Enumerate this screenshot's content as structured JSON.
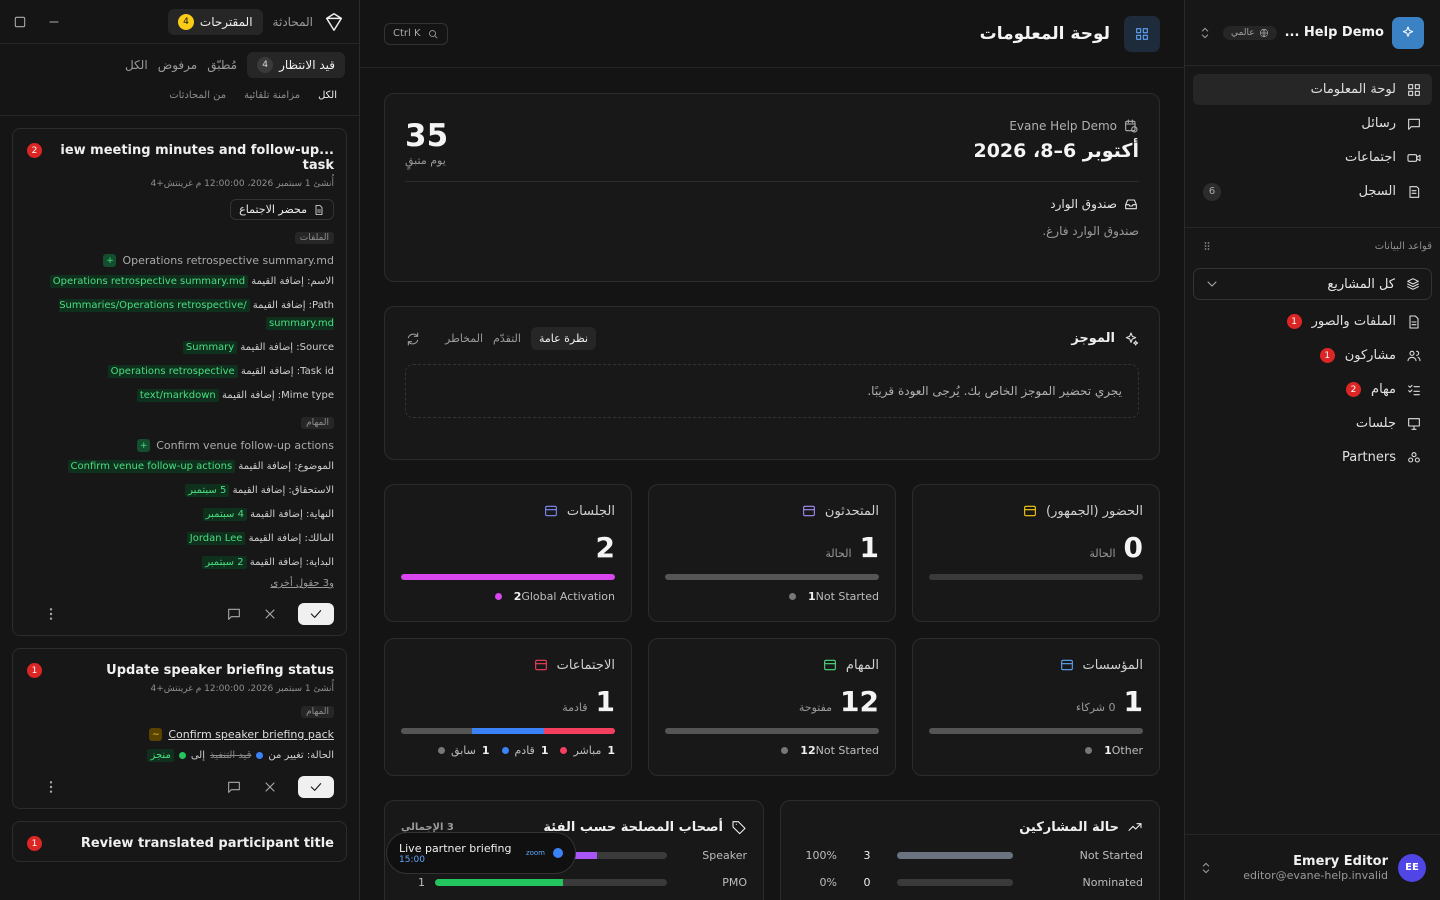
{
  "sidebar": {
    "workspace_name": "Help Demo ...",
    "workspace_badge": "عالمي",
    "nav": [
      {
        "label": "لوحة المعلومات",
        "icon": "dashboard-icon",
        "active": true
      },
      {
        "label": "رسائل",
        "icon": "message-icon"
      },
      {
        "label": "اجتماعات",
        "icon": "video-icon"
      },
      {
        "label": "السجل",
        "icon": "log-icon",
        "count": "6"
      }
    ],
    "section_label": "قواعد البيانات",
    "project_select": "كل المشاريع",
    "db_items": [
      {
        "label": "الملفات والصور",
        "badge": "1"
      },
      {
        "label": "مشاركون",
        "badge": "1"
      },
      {
        "label": "مهام",
        "badge": "2"
      },
      {
        "label": "جلسات",
        "badge": ""
      },
      {
        "label": "Partners",
        "badge": ""
      }
    ],
    "user": {
      "initials": "EE",
      "name": "Emery Editor",
      "email": "editor@evane-help.invalid"
    }
  },
  "left": {
    "tabs": {
      "suggestions": "المقترحات",
      "suggestions_count": "4",
      "conversation": "المحادثة"
    },
    "filters": {
      "pending": "قيد الانتظار",
      "pending_count": "4",
      "applied": "مُطبّق",
      "rejected": "مرفوض",
      "all": "الكل"
    },
    "sources": {
      "all": "الكل",
      "auto_sync": "مزامنة تلقائية",
      "from_chats": "من المحادثات"
    },
    "card1": {
      "badge": "2",
      "title": "...iew meeting minutes and follow-up task",
      "date": "أُنشئ 1 سبتمبر 2026، 12:00:00 م غرينتش+4",
      "doc_button": "محضر الاجتماع",
      "tag_files": "الملفات",
      "file_record": "Operations retrospective summary.md",
      "file_fields": [
        {
          "label": "الاسم: إضافة القيمة",
          "value": "Operations retrospective summary.md"
        },
        {
          "label": "Path: إضافة القيمة",
          "value": "/Summaries/Operations retrospective summary.md"
        },
        {
          "label": "Source: إضافة القيمة",
          "value": "Summary"
        },
        {
          "label": "Task id: إضافة القيمة",
          "value": "Operations retrospective"
        },
        {
          "label": "Mime type: إضافة القيمة",
          "value": "text/markdown"
        }
      ],
      "tag_tasks": "المهام",
      "task_record": "Confirm venue follow-up actions",
      "task_fields": [
        {
          "label": "الموضوع: إضافة القيمة",
          "value": "Confirm venue follow-up actions"
        },
        {
          "label": "الاستحقاق: إضافة القيمة",
          "value": "5 سبتمبر"
        },
        {
          "label": "النهاية: إضافة القيمة",
          "value": "4 سبتمبر"
        },
        {
          "label": "المالك: إضافة القيمة",
          "value": "Jordan Lee"
        },
        {
          "label": "البداية: إضافة القيمة",
          "value": "2 سبتمبر"
        }
      ],
      "more": "و3 حقول أخرى"
    },
    "card2": {
      "badge": "1",
      "title": "Update speaker briefing status",
      "date": "أُنشئ 1 سبتمبر 2026، 12:00:00 م غرينتش+4",
      "tag_tasks": "المهام",
      "task_record": "Confirm speaker briefing pack",
      "status_label": "الحالة: تغيير من",
      "status_from": "قيد التنفيذ",
      "status_to_sep": "إلى",
      "status_to": "منجز"
    },
    "card3": {
      "badge": "1",
      "title": "Review translated participant title"
    }
  },
  "main": {
    "title": "لوحة المعلومات",
    "search_shortcut": "Ctrl K",
    "calendar": {
      "org": "Evane Help Demo",
      "range": "أكتوبر 6–8، 2026",
      "days": "35",
      "days_label": "يوم متبقٍ"
    },
    "inbox": {
      "title": "صندوق الوارد",
      "empty": "صندوق الوارد فارغ."
    },
    "brief": {
      "title": "الموجز",
      "tabs": [
        "نظرة عامة",
        "التقدّم",
        "المخاطر"
      ],
      "message": "يجري تحضير الموجز الخاص بك. يُرجى العودة قريبًا."
    },
    "stats": [
      {
        "title": "الحضور (الجمهور)",
        "value": "0",
        "sub": "الحالة",
        "color": "#facc15",
        "legend": []
      },
      {
        "title": "المتحدثون",
        "value": "1",
        "sub": "الحالة",
        "color": "#a78bfa",
        "legend": [
          {
            "n": "1",
            "label": "Not Started",
            "color": "#777"
          }
        ]
      },
      {
        "title": "الجلسات",
        "value": "2",
        "sub": "",
        "color": "#818cf8",
        "legend": [
          {
            "n": "2",
            "label": "Global Activation",
            "color": "#d946ef"
          }
        ]
      },
      {
        "title": "المؤسسات",
        "value": "1",
        "sub": "0 شركاء",
        "color": "#60a5fa",
        "legend": [
          {
            "n": "1",
            "label": "Other",
            "color": "#777"
          }
        ]
      },
      {
        "title": "المهام",
        "value": "12",
        "sub": "مفتوحة",
        "color": "#4ade80",
        "legend": [
          {
            "n": "12",
            "label": "Not Started",
            "color": "#777"
          }
        ]
      },
      {
        "title": "الاجتماعات",
        "value": "1",
        "sub": "قادمة",
        "color": "#f43f5e",
        "legend": [
          {
            "n": "1",
            "label": "مباشر",
            "color": "#f43f5e"
          },
          {
            "n": "1",
            "label": "قادم",
            "color": "#3b82f6"
          },
          {
            "n": "1",
            "label": "سابق",
            "color": "#777"
          }
        ]
      }
    ],
    "stakeholders": {
      "title": "أصحاب المصلحة حسب الفئة",
      "total": "3 الإجمالي",
      "rows": [
        {
          "label": "Speaker",
          "n": "",
          "frac": 0.7
        },
        {
          "label": "PMO",
          "n": "1",
          "frac": 0.55
        }
      ]
    },
    "participants": {
      "title": "حالة المشاركين",
      "rows": [
        {
          "label": "Not Started",
          "n": "3",
          "pct": "100%",
          "frac": 1.0
        },
        {
          "label": "Nominated",
          "n": "0",
          "pct": "0%",
          "frac": 0.0
        }
      ]
    },
    "toast": {
      "title": "Live partner briefing",
      "time": "15:00",
      "app": "zoom"
    }
  }
}
